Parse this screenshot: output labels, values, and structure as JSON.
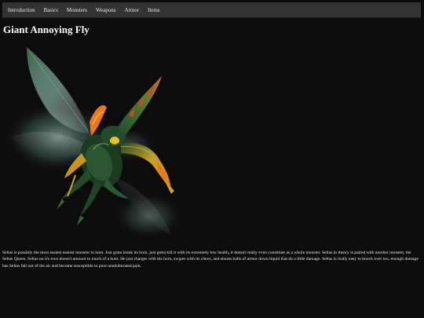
{
  "nav": {
    "items": [
      {
        "label": "Introduction"
      },
      {
        "label": "Basics"
      },
      {
        "label": "Monsters"
      },
      {
        "label": "Weapons"
      },
      {
        "label": "Armor"
      },
      {
        "label": "Items"
      }
    ]
  },
  "page": {
    "title": "Giant Annoying Fly",
    "description": "Seltas is possibly the most easiest easiest monster to hunt. Just gotta break its horn, just gotta kill it with its extremely low health, it doesn't really even constitute as a whole monster. Seltas in theory is paired with another monster, the Seltas Queen, Seltas on it's own doesn't amount to much of a hunt. He just charges with his horn, swipes with its claws, and shoots balls of armor down liquid that do a little damage. Seltas is really easy to knock over too, enough damage has Seltas fall out of the air and become susceptible to pure unadulterated pain."
  },
  "colors": {
    "background": "#0c0c0c",
    "navbar": "#333333",
    "insect_body": "#1b3a22",
    "insect_accent": "#e8781c",
    "wing": "#9fd3c6"
  }
}
